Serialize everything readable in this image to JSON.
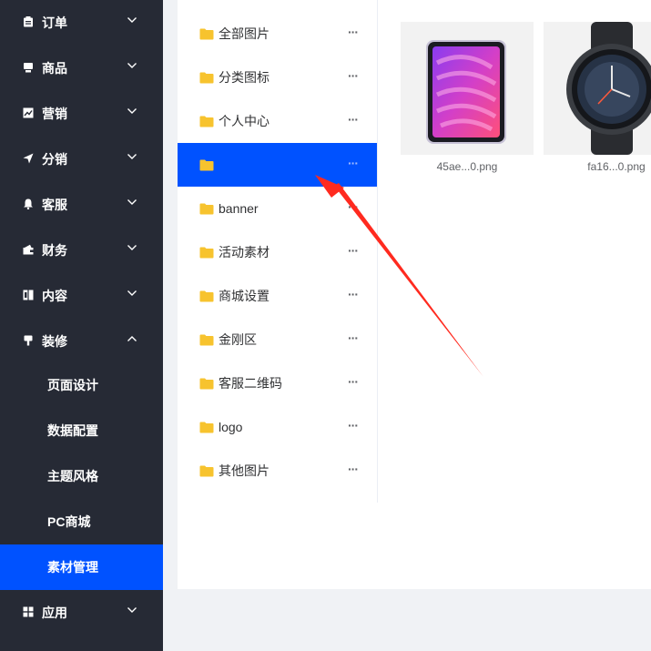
{
  "sidebar": {
    "menu": [
      {
        "label": "订单",
        "icon": "clipboard-icon",
        "expanded": false
      },
      {
        "label": "商品",
        "icon": "package-icon",
        "expanded": false
      },
      {
        "label": "营销",
        "icon": "trend-chart-icon",
        "expanded": false
      },
      {
        "label": "分销",
        "icon": "paper-plane-icon",
        "expanded": false
      },
      {
        "label": "客服",
        "icon": "bell-icon",
        "expanded": false
      },
      {
        "label": "财务",
        "icon": "wallet-icon",
        "expanded": false
      },
      {
        "label": "内容",
        "icon": "book-icon",
        "expanded": false
      },
      {
        "label": "装修",
        "icon": "paint-brush-icon",
        "expanded": true
      },
      {
        "label": "应用",
        "icon": "grid-icon",
        "expanded": false
      }
    ],
    "submenu": [
      {
        "label": "页面设计"
      },
      {
        "label": "数据配置"
      },
      {
        "label": "主题风格"
      },
      {
        "label": "PC商城"
      },
      {
        "label": "素材管理",
        "active": true
      }
    ]
  },
  "folders": [
    {
      "label": "全部图片"
    },
    {
      "label": "分类图标"
    },
    {
      "label": "个人中心"
    },
    {
      "label": "",
      "active": true
    },
    {
      "label": "banner"
    },
    {
      "label": "活动素材"
    },
    {
      "label": "商城设置"
    },
    {
      "label": "金刚区"
    },
    {
      "label": "客服二维码"
    },
    {
      "label": "logo"
    },
    {
      "label": "其他图片"
    }
  ],
  "folder_more_label": "···",
  "files": [
    {
      "name": "45ae...0.png",
      "thumbnail": "tablet-product-icon"
    },
    {
      "name": "fa16...0.png",
      "thumbnail": "smartwatch-product-icon"
    }
  ],
  "colors": {
    "sidebar_bg": "#262a35",
    "accent": "#0052ff",
    "folder_icon": "#f7c32e",
    "annotation_arrow": "#ff2a1f"
  }
}
